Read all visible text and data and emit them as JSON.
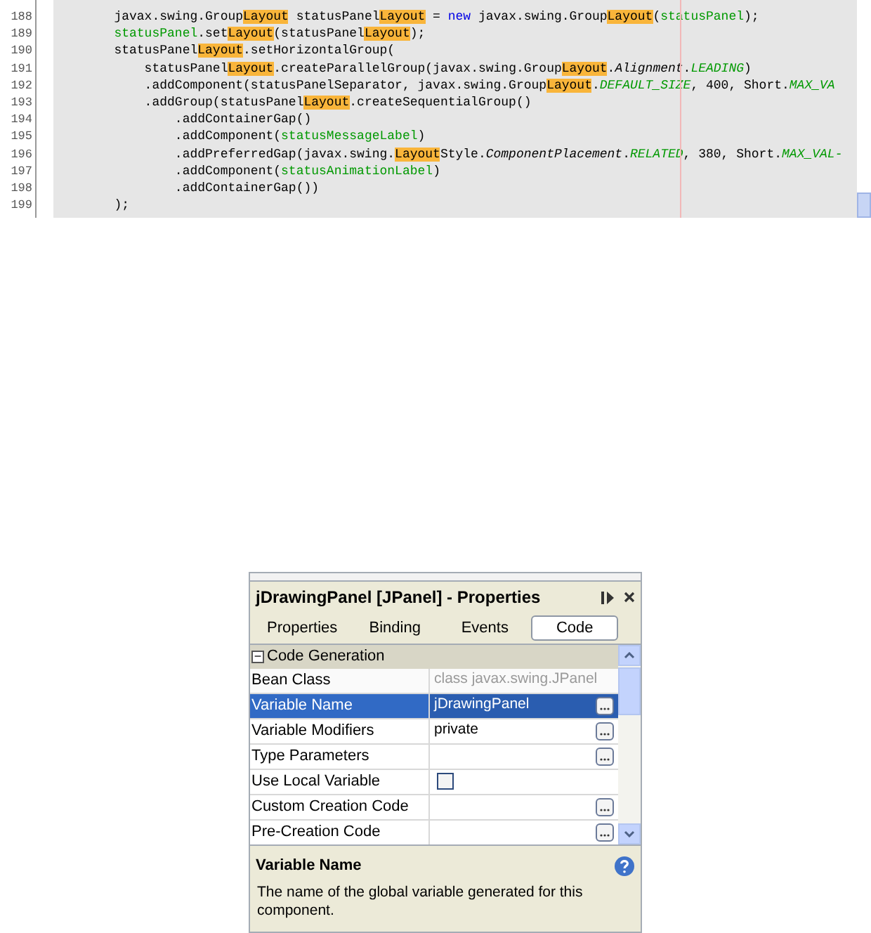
{
  "editor": {
    "lines": [
      {
        "number": "188",
        "tokens": [
          {
            "kind": "plain",
            "text": "        javax.swing.Group"
          },
          {
            "kind": "match",
            "text": "Layout"
          },
          {
            "kind": "plain",
            "text": " statusPanel"
          },
          {
            "kind": "match",
            "text": "Layout"
          },
          {
            "kind": "plain",
            "text": " = "
          },
          {
            "kind": "keyword",
            "text": "new"
          },
          {
            "kind": "plain",
            "text": " javax.swing.Group"
          },
          {
            "kind": "match",
            "text": "Layout"
          },
          {
            "kind": "plain",
            "text": "("
          },
          {
            "kind": "field",
            "text": "statusPanel"
          },
          {
            "kind": "plain",
            "text": ");"
          }
        ]
      },
      {
        "number": "189",
        "tokens": [
          {
            "kind": "field",
            "text": "        statusPanel"
          },
          {
            "kind": "plain",
            "text": ".set"
          },
          {
            "kind": "match",
            "text": "Layout"
          },
          {
            "kind": "plain",
            "text": "(statusPanel"
          },
          {
            "kind": "match",
            "text": "Layout"
          },
          {
            "kind": "plain",
            "text": ");"
          }
        ]
      },
      {
        "number": "190",
        "tokens": [
          {
            "kind": "plain",
            "text": "        statusPanel"
          },
          {
            "kind": "match",
            "text": "Layout"
          },
          {
            "kind": "plain",
            "text": ".setHorizontalGroup("
          }
        ]
      },
      {
        "number": "191",
        "tokens": [
          {
            "kind": "plain",
            "text": "            statusPanel"
          },
          {
            "kind": "match",
            "text": "Layout"
          },
          {
            "kind": "plain",
            "text": ".createParallelGroup(javax.swing.Group"
          },
          {
            "kind": "match",
            "text": "Layout"
          },
          {
            "kind": "plain",
            "text": "."
          },
          {
            "kind": "static",
            "text": "Alignment"
          },
          {
            "kind": "plain",
            "text": "."
          },
          {
            "kind": "constant",
            "text": "LEADING"
          },
          {
            "kind": "plain",
            "text": ")"
          }
        ]
      },
      {
        "number": "192",
        "tokens": [
          {
            "kind": "plain",
            "text": "            .addComponent(statusPanelSeparator, javax.swing.Group"
          },
          {
            "kind": "match",
            "text": "Layout"
          },
          {
            "kind": "plain",
            "text": "."
          },
          {
            "kind": "constant",
            "text": "DEFAULT_SIZE"
          },
          {
            "kind": "plain",
            "text": ", 400, Short."
          },
          {
            "kind": "constant",
            "text": "MAX_VA"
          }
        ]
      },
      {
        "number": "193",
        "tokens": [
          {
            "kind": "plain",
            "text": "            .addGroup(statusPanel"
          },
          {
            "kind": "match",
            "text": "Layout"
          },
          {
            "kind": "plain",
            "text": ".createSequentialGroup()"
          }
        ]
      },
      {
        "number": "194",
        "tokens": [
          {
            "kind": "plain",
            "text": "                .addContainerGap()"
          }
        ]
      },
      {
        "number": "195",
        "tokens": [
          {
            "kind": "plain",
            "text": "                .addComponent("
          },
          {
            "kind": "field",
            "text": "statusMessageLabel"
          },
          {
            "kind": "plain",
            "text": ")"
          }
        ]
      },
      {
        "number": "196",
        "tokens": [
          {
            "kind": "plain",
            "text": "                .addPreferredGap(javax.swing."
          },
          {
            "kind": "match",
            "text": "Layout"
          },
          {
            "kind": "plain",
            "text": "Style."
          },
          {
            "kind": "static",
            "text": "ComponentPlacement"
          },
          {
            "kind": "plain",
            "text": "."
          },
          {
            "kind": "constant",
            "text": "RELATED"
          },
          {
            "kind": "plain",
            "text": ", 380, Short."
          },
          {
            "kind": "constant",
            "text": "MAX_VAL-"
          }
        ]
      },
      {
        "number": "197",
        "tokens": [
          {
            "kind": "plain",
            "text": "                .addComponent("
          },
          {
            "kind": "field",
            "text": "statusAnimationLabel"
          },
          {
            "kind": "plain",
            "text": ")"
          }
        ]
      },
      {
        "number": "198",
        "tokens": [
          {
            "kind": "plain",
            "text": "                .addContainerGap())"
          }
        ]
      },
      {
        "number": "199",
        "tokens": [
          {
            "kind": "plain",
            "text": "        );"
          }
        ]
      }
    ]
  },
  "properties_panel": {
    "title": "jDrawingPanel [JPanel] - Properties",
    "tabs": [
      {
        "label": "Properties",
        "selected": false
      },
      {
        "label": "Binding",
        "selected": false
      },
      {
        "label": "Events",
        "selected": false
      },
      {
        "label": "Code",
        "selected": true
      }
    ],
    "section": {
      "expander": "−",
      "label": "Code Generation",
      "expanded": true
    },
    "rows": [
      {
        "name": "Bean Class",
        "kind": "text",
        "value": "class javax.swing.JPanel",
        "disabled": true,
        "ellipsis": false,
        "selected": false
      },
      {
        "name": "Variable Name",
        "kind": "text",
        "value": "jDrawingPanel",
        "disabled": false,
        "ellipsis": true,
        "selected": true
      },
      {
        "name": "Variable Modifiers",
        "kind": "text",
        "value": "private",
        "disabled": false,
        "ellipsis": true,
        "selected": false
      },
      {
        "name": "Type Parameters",
        "kind": "text",
        "disabled": false,
        "ellipsis": true,
        "selected": false
      },
      {
        "name": "Use Local Variable",
        "kind": "checkbox",
        "checked": false,
        "disabled": false,
        "ellipsis": false,
        "selected": false
      },
      {
        "name": "Custom Creation Code",
        "kind": "text",
        "disabled": false,
        "ellipsis": true,
        "selected": false
      },
      {
        "name": "Pre-Creation Code",
        "kind": "text",
        "disabled": false,
        "ellipsis": true,
        "selected": false
      }
    ],
    "description": {
      "title": "Variable Name",
      "text": "The name of the global variable generated for this component."
    }
  }
}
